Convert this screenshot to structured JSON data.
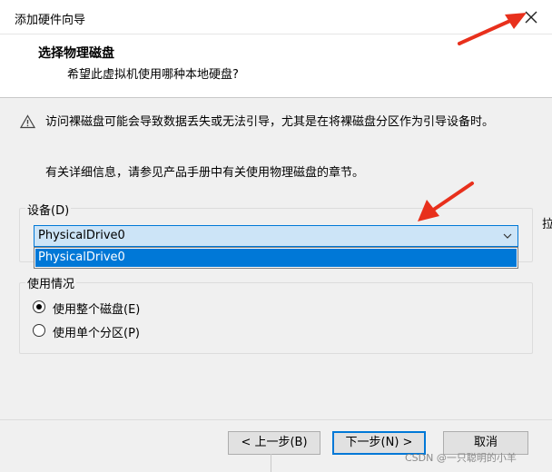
{
  "window": {
    "title": "添加硬件向导",
    "close_icon": "close-icon"
  },
  "header": {
    "title": "选择物理磁盘",
    "subtitle": "希望此虚拟机使用哪种本地硬盘?"
  },
  "warning": {
    "icon": "warning-icon",
    "text": "访问裸磁盘可能会导致数据丢失或无法引导，尤其是在将裸磁盘分区作为引导设备时。"
  },
  "detail_text": "有关详细信息，请参见产品手册中有关使用物理磁盘的章节。",
  "device": {
    "group_label": "设备(D)",
    "selected_value": "PhysicalDrive0",
    "options": [
      "PhysicalDrive0"
    ]
  },
  "usage": {
    "group_label": "使用情况",
    "options": [
      {
        "label": "使用整个磁盘(E)",
        "checked": true
      },
      {
        "label": "使用单个分区(P)",
        "checked": false
      }
    ]
  },
  "buttons": {
    "back": "< 上一步(B)",
    "next": "下一步(N) >",
    "cancel": "取消"
  },
  "edge_glyph": "拉",
  "watermark": "CSDN @一只聪明的小羊",
  "colors": {
    "accent": "#0078d7",
    "selection": "#cce4f7",
    "annotation": "#e8301c"
  }
}
